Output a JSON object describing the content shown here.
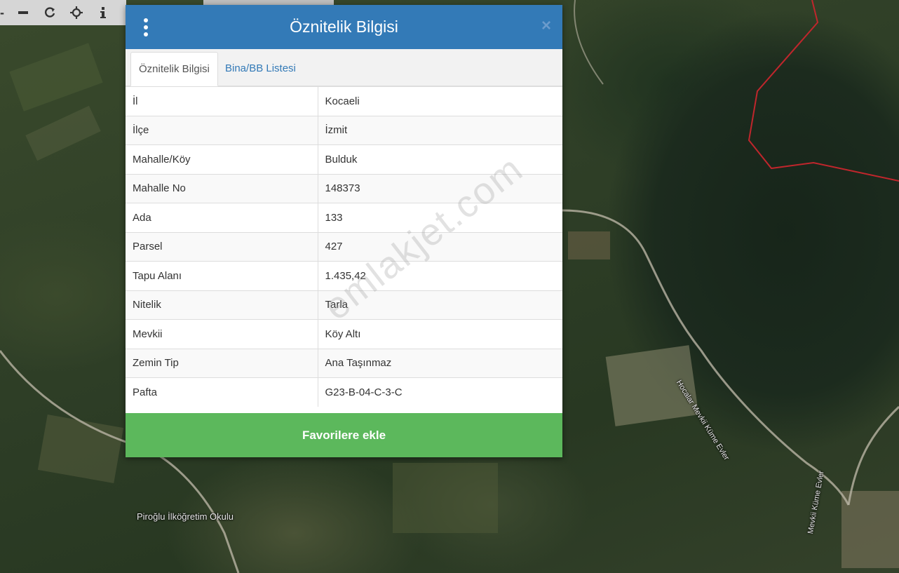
{
  "toolbar": {
    "zoom_out_icon": "minus-icon",
    "refresh_icon": "refresh-icon",
    "locate_icon": "crosshair-icon",
    "info_icon": "info-icon"
  },
  "map": {
    "labels": {
      "school": "Piroğlu İlköğretim Okulu",
      "road1": "Hocalar Mevkii Küme Evler",
      "road2": "Mevkii Küme Evler"
    },
    "parcel_border_color": "#c0262c"
  },
  "modal": {
    "title": "Öznitelik Bilgisi",
    "close_label": "×",
    "tabs": [
      {
        "label": "Öznitelik Bilgisi",
        "active": true
      },
      {
        "label": "Bina/BB Listesi",
        "active": false
      }
    ],
    "rows": [
      {
        "key": "İl",
        "value": "Kocaeli"
      },
      {
        "key": "İlçe",
        "value": "İzmit"
      },
      {
        "key": "Mahalle/Köy",
        "value": "Bulduk"
      },
      {
        "key": "Mahalle No",
        "value": "148373"
      },
      {
        "key": "Ada",
        "value": "133"
      },
      {
        "key": "Parsel",
        "value": "427"
      },
      {
        "key": "Tapu Alanı",
        "value": "1.435,42"
      },
      {
        "key": "Nitelik",
        "value": "Tarla"
      },
      {
        "key": "Mevkii",
        "value": "Köy Altı"
      },
      {
        "key": "Zemin Tip",
        "value": "Ana Taşınmaz"
      },
      {
        "key": "Pafta",
        "value": "G23-B-04-C-3-C"
      }
    ],
    "favorite_button": "Favorilere ekle",
    "header_color": "#337ab7",
    "button_color": "#5cb85c"
  },
  "watermark": "emlakjet.com"
}
